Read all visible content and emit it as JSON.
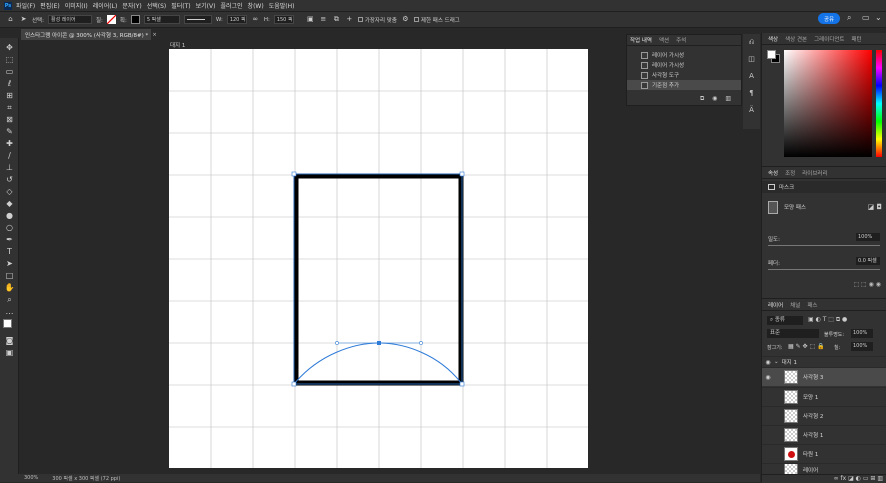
{
  "menubar": {
    "app_logo": "Ps",
    "items": [
      "파일(F)",
      "편집(E)",
      "이미지(I)",
      "레이어(L)",
      "문자(Y)",
      "선택(S)",
      "필터(T)",
      "보기(V)",
      "플러그인",
      "창(W)",
      "도움말(H)"
    ]
  },
  "options": {
    "select_label": "선택:",
    "select_value": "활성 레이어",
    "fill_label": "칠:",
    "stroke_label": "획:",
    "stroke_width": "5 픽셀",
    "w_label": "W:",
    "w_value": "120 픽",
    "h_label": "H:",
    "h_value": "150 픽",
    "align_edges": "가장자리 맞춤",
    "constrain_path": "제한 패스 드래그",
    "share_label": "공유"
  },
  "document": {
    "tab_title": "인스타그램 아이콘 @ 300% (사각형 3, RGB/8#) *",
    "artboard_label": "대지 1",
    "zoom": "300%",
    "doc_info": "300 픽셀 x 300 픽셀 (72 ppi)"
  },
  "history_panel": {
    "tabs": [
      "작업 내역",
      "액션",
      "주석"
    ],
    "items": [
      "레이어 가시성",
      "레이어 가시성",
      "사각형 도구",
      "기준점 추가"
    ],
    "selected_index": 3
  },
  "color_panel": {
    "tabs": [
      "색상",
      "색상 견본",
      "그레이디언트",
      "패턴"
    ],
    "foreground": "#ffffff",
    "background": "#000000",
    "accent_hue": "#ff0000"
  },
  "properties_panel": {
    "tabs": [
      "속성",
      "조정",
      "라이브러리"
    ],
    "mask_label": "마스크",
    "vector_mask_label": "모양 패스",
    "density_label": "밀도:",
    "density_value": "100%",
    "feather_label": "페더:",
    "feather_value": "0.0 픽셀"
  },
  "layers_panel": {
    "tabs": [
      "레이어",
      "채널",
      "패스"
    ],
    "filter_label": "종류",
    "blend_mode": "표준",
    "opacity_label": "불투명도:",
    "opacity_value": "100%",
    "lock_label": "잠그기:",
    "fill_label": "칠:",
    "fill_value": "100%",
    "artboard_name": "대지 1",
    "layers": [
      {
        "name": "사각형 3",
        "visible": true,
        "selected": true
      },
      {
        "name": "모양 1",
        "visible": false,
        "selected": false
      },
      {
        "name": "사각형 2",
        "visible": false,
        "selected": false
      },
      {
        "name": "사각형 1",
        "visible": false,
        "selected": false
      },
      {
        "name": "타원 1",
        "visible": false,
        "selected": false
      },
      {
        "name": "레이어",
        "visible": false,
        "selected": false
      }
    ]
  },
  "colors": {
    "ui_dark": "#282828",
    "panel": "#323232",
    "accent_blue": "#1473e6",
    "path_blue": "#2f7bd8"
  }
}
